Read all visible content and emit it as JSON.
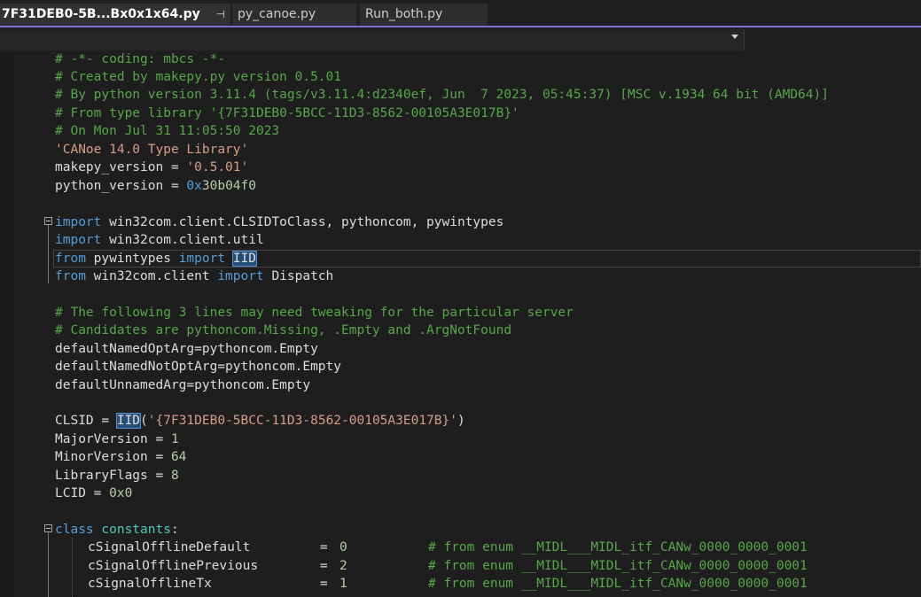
{
  "tabs": [
    {
      "label": "7F31DEB0-5B...Bx0x1x64.py",
      "active": true,
      "pinned": true
    },
    {
      "label": "py_canoe.py",
      "active": false
    },
    {
      "label": "Run_both.py",
      "active": false
    }
  ],
  "accent_color": "#7e6fd6",
  "pin_icon": "⊣",
  "code": {
    "l1": "# -*- coding: mbcs -*-",
    "l2": "# Created by makepy.py version 0.5.01",
    "l3": "# By python version 3.11.4 (tags/v3.11.4:d2340ef, Jun  7 2023, 05:45:37) [MSC v.1934 64 bit (AMD64)]",
    "l4": "# From type library '{7F31DEB0-5BCC-11D3-8562-00105A3E017B}'",
    "l5": "# On Mon Jul 31 11:05:50 2023",
    "l6": "'CANoe 14.0 Type Library'",
    "l7_name": "makepy_version = ",
    "l7_val": "'0.5.01'",
    "l8_name": "python_version = ",
    "l8_val_a": "0x",
    "l8_val_b": "30b04f0",
    "l10_kw": "import",
    "l10_rest": " win32com.client.CLSIDToClass, pythoncom, pywintypes",
    "l11_kw": "import",
    "l11_rest": " win32com.client.util",
    "l12_kw1": "from",
    "l12_mid": " pywintypes ",
    "l12_kw2": "import",
    "l12_sp": " ",
    "l12_sel": "IID",
    "l13_kw1": "from",
    "l13_mid": " win32com.client ",
    "l13_kw2": "import",
    "l13_rest": " Dispatch",
    "l15": "# The following 3 lines may need tweaking for the particular server",
    "l16": "# Candidates are pythoncom.Missing, .Empty and .ArgNotFound",
    "l17": "defaultNamedOptArg=pythoncom.Empty",
    "l18": "defaultNamedNotOptArg=pythoncom.Empty",
    "l19": "defaultUnnamedArg=pythoncom.Empty",
    "l21_a": "CLSID = ",
    "l21_sel": "IID",
    "l21_b": "(",
    "l21_str": "'{7F31DEB0-5BCC-11D3-8562-00105A3E017B}'",
    "l21_c": ")",
    "l22_a": "MajorVersion = ",
    "l22_n": "1",
    "l23_a": "MinorVersion = ",
    "l23_n": "64",
    "l24_a": "LibraryFlags = ",
    "l24_n": "8",
    "l25_a": "LCID = ",
    "l25_n": "0x0",
    "l27_kw": "class",
    "l27_sp": " ",
    "l27_name": "constants",
    "l27_colon": ":",
    "rows": [
      {
        "name": "cSignalOfflineDefault         =",
        "val": "0",
        "comment": "# from enum __MIDL___MIDL_itf_CANw_0000_0000_0001"
      },
      {
        "name": "cSignalOfflinePrevious        =",
        "val": "2",
        "comment": "# from enum __MIDL___MIDL_itf_CANw_0000_0000_0001"
      },
      {
        "name": "cSignalOfflineTx              =",
        "val": "1",
        "comment": "# from enum __MIDL___MIDL_itf_CANw_0000_0000_0001"
      }
    ]
  }
}
